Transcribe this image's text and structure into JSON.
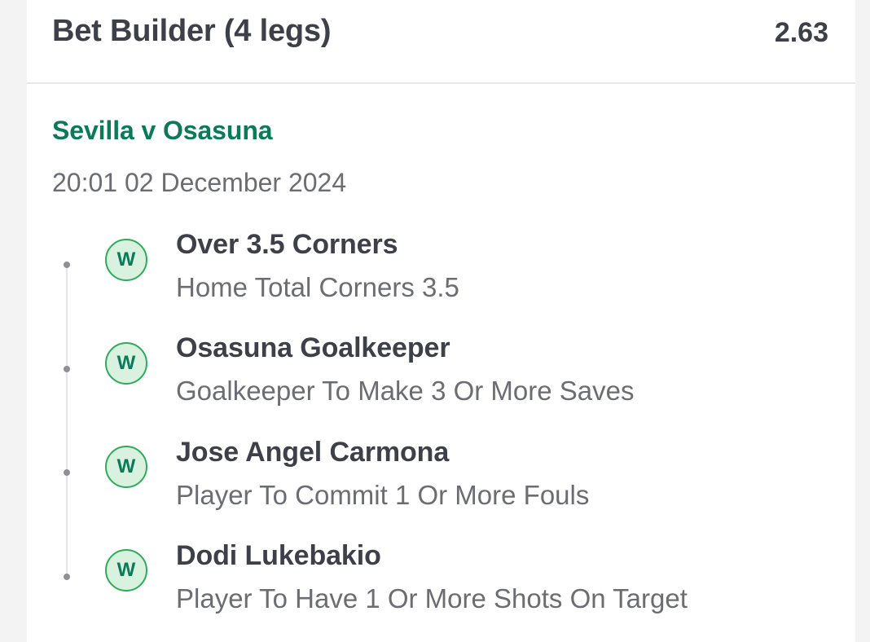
{
  "bet": {
    "title": "Bet Builder (4 legs)",
    "odds": "2.63"
  },
  "event": {
    "title": "Sevilla v Osasuna",
    "datetime": "20:01 02 December 2024"
  },
  "legs": [
    {
      "selection": "Over 3.5 Corners",
      "market": "Home Total Corners 3.5",
      "status": "W"
    },
    {
      "selection": "Osasuna Goalkeeper",
      "market": "Goalkeeper To Make 3 Or More Saves",
      "status": "W"
    },
    {
      "selection": "Jose Angel Carmona",
      "market": "Player To Commit 1 Or More Fouls",
      "status": "W"
    },
    {
      "selection": "Dodi Lukebakio",
      "market": "Player To Have 1 Or More Shots On Target",
      "status": "W"
    }
  ],
  "colors": {
    "accent_green": "#0a7a58",
    "win_badge_bg": "#d9f1df",
    "win_badge_border": "#2dac59",
    "text_primary": "#3d4049",
    "text_secondary": "#6b6d73"
  }
}
